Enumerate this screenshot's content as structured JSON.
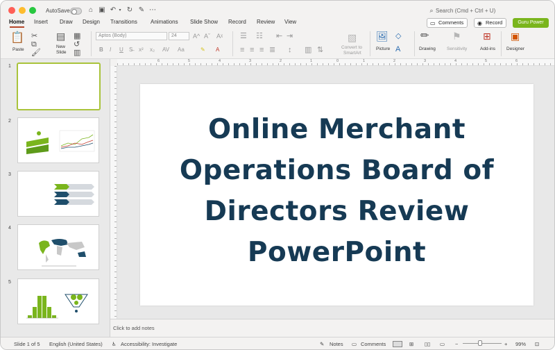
{
  "titlebar": {
    "autosave_label": "AutoSave",
    "search_placeholder": "Search (Cmd + Ctrl + U)"
  },
  "tabs": [
    "Home",
    "Insert",
    "Draw",
    "Design",
    "Transitions",
    "Animations",
    "Slide Show",
    "Record",
    "Review",
    "View"
  ],
  "top_buttons": {
    "comments": "Comments",
    "record": "Record",
    "guru": "Guru Power"
  },
  "ribbon": {
    "paste": "Paste",
    "new_slide_1": "New",
    "new_slide_2": "Slide",
    "font_name": "Aptos (Body)",
    "font_size": "24",
    "convert_1": "Convert to",
    "convert_2": "SmartArt",
    "picture": "Picture",
    "drawing": "Drawing",
    "sensitivity": "Sensitivity",
    "addins": "Add-ins",
    "designer": "Designer"
  },
  "ruler_numbers": [
    "6",
    "5",
    "4",
    "3",
    "2",
    "1",
    "0",
    "1",
    "2",
    "3",
    "4",
    "5",
    "6"
  ],
  "thumbnails": [
    {
      "number": "1"
    },
    {
      "number": "2"
    },
    {
      "number": "3"
    },
    {
      "number": "4"
    },
    {
      "number": "5"
    }
  ],
  "slide": {
    "title_lines": [
      "Online Merchant",
      "Operations Board of",
      "Directors Review",
      "PowerPoint"
    ]
  },
  "notes_placeholder": "Click to add notes",
  "status": {
    "slide_count": "Slide 1 of 5",
    "language": "English (United States)",
    "accessibility": "Accessibility: Investigate",
    "notes": "Notes",
    "comments": "Comments",
    "zoom": "99%"
  },
  "colors": {
    "accent_tab": "#b7472a",
    "guru_green": "#7ab51d",
    "title_navy": "#163a54",
    "thumb_green": "#7ab51d",
    "thumb_navy": "#1f4e6b"
  }
}
